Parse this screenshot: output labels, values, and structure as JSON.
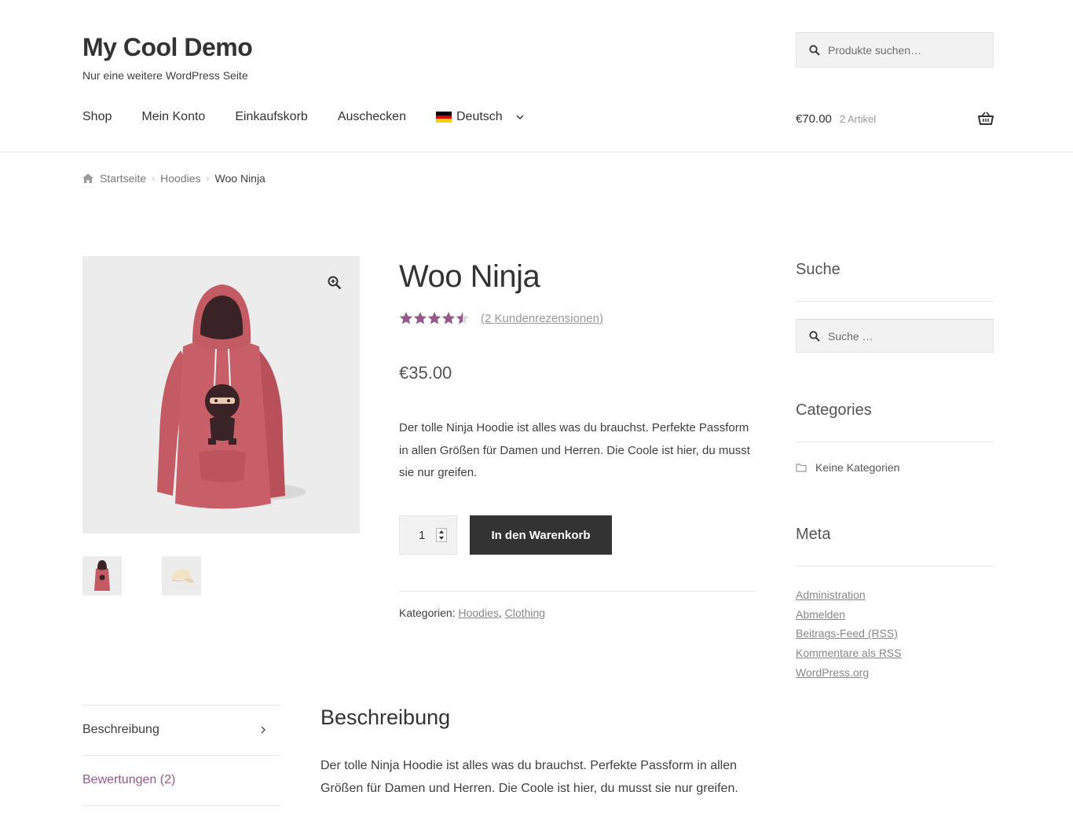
{
  "site": {
    "title": "My Cool Demo",
    "tagline": "Nur eine weitere WordPress Seite"
  },
  "header_search": {
    "placeholder": "Produkte suchen…",
    "icon": "search-icon"
  },
  "nav": {
    "items": [
      "Shop",
      "Mein Konto",
      "Einkaufskorb",
      "Auschecken"
    ],
    "language": "Deutsch",
    "language_flag": "german-flag-icon"
  },
  "cart": {
    "total": "€70.00",
    "count": "2 Artikel",
    "icon": "basket-icon"
  },
  "breadcrumb": {
    "items": [
      "Startseite",
      "Hoodies"
    ],
    "current": "Woo Ninja"
  },
  "product": {
    "title": "Woo Ninja",
    "rating": 4.5,
    "rating_max": 5,
    "review_link": "(2 Kundenrezensionen)",
    "price": "€35.00",
    "short_description": "Der tolle Ninja Hoodie ist alles was du brauchst. Perfekte Passform in allen Größen für Damen und Herren. Die Coole ist hier, du musst sie nur greifen.",
    "quantity": "1",
    "add_to_cart": "In den Warenkorb",
    "categories_label": "Kategorien:",
    "categories": [
      "Hoodies",
      "Clothing"
    ]
  },
  "sidebar": {
    "search_title": "Suche",
    "search_placeholder": "Suche …",
    "categories_title": "Categories",
    "no_categories": "Keine Kategorien",
    "meta_title": "Meta",
    "meta_links": [
      "Administration",
      "Abmelden",
      "Beitrags-Feed (RSS)",
      "Kommentare als RSS",
      "WordPress.org"
    ]
  },
  "tabs": {
    "items": [
      "Beschreibung",
      "Bewertungen (2)"
    ],
    "panel_title": "Beschreibung",
    "panel_text": "Der tolle Ninja Hoodie ist alles was du brauchst. Perfekte Passform in allen Größen für Damen und Herren. Die Coole ist hier, du musst sie nur greifen."
  },
  "colors": {
    "accent": "#96588a",
    "button_bg": "#333333",
    "hoodie": "#c45a63"
  }
}
